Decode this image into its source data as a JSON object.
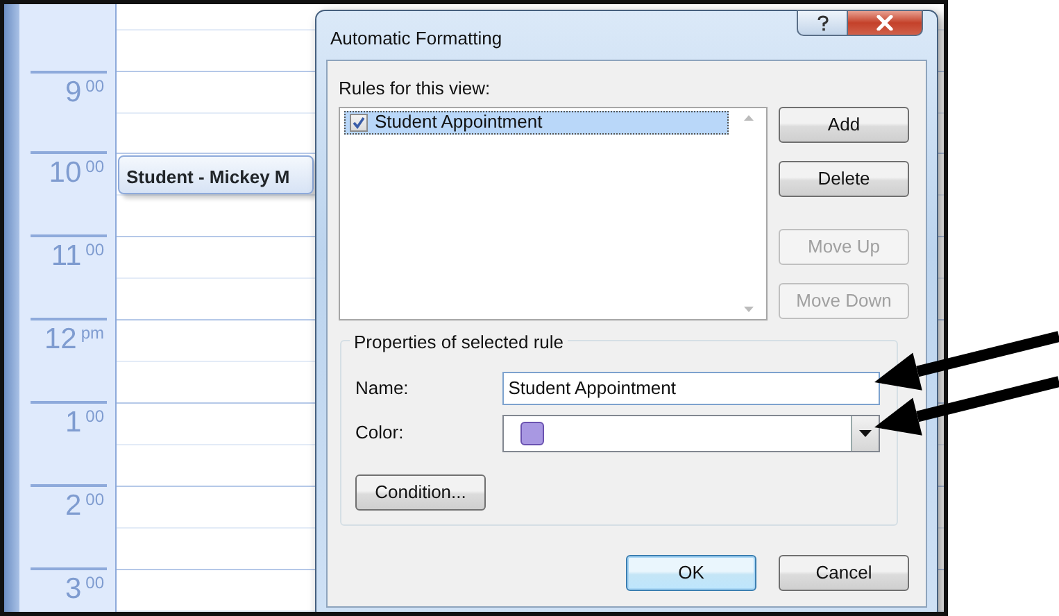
{
  "calendar": {
    "hours": [
      {
        "label": "9$^{00}$"
      },
      {
        "label": "10$^{00}$",
        "appointments": [
          {
            "title": "Student - Mickey M"
          }
        ]
      },
      {
        "label": "11$^{00}$"
      },
      {
        "label": "12$^{pm}$"
      },
      {
        "label": "1$^{00}$"
      },
      {
        "label": "2$^{00}$"
      },
      {
        "label": "3$^{00}$"
      }
    ]
  },
  "dialog": {
    "title": "Automatic Formatting",
    "rules_label": "Rules for this view:",
    "rules": [
      {
        "label": "Student Appointment",
        "checked": true,
        "selected": true
      }
    ],
    "side_buttons": [
      {
        "label": "Add",
        "disabled": false
      },
      {
        "label": "Delete",
        "disabled": false
      },
      {
        "label": "Move Up",
        "disabled": true
      },
      {
        "label": "Move Down",
        "disabled": true
      }
    ],
    "properties": {
      "legend": "Properties of selected rule",
      "name_label": "Name:",
      "name_value": "Student Appointment",
      "name_arrow": true,
      "color_label": "Color:",
      "color": "#a898e2",
      "color_arrow": true,
      "condition_button": "Condition..."
    },
    "buttons": [
      {
        "label": "OK",
        "default": true
      },
      {
        "label": "Cancel",
        "default": false
      }
    ]
  }
}
